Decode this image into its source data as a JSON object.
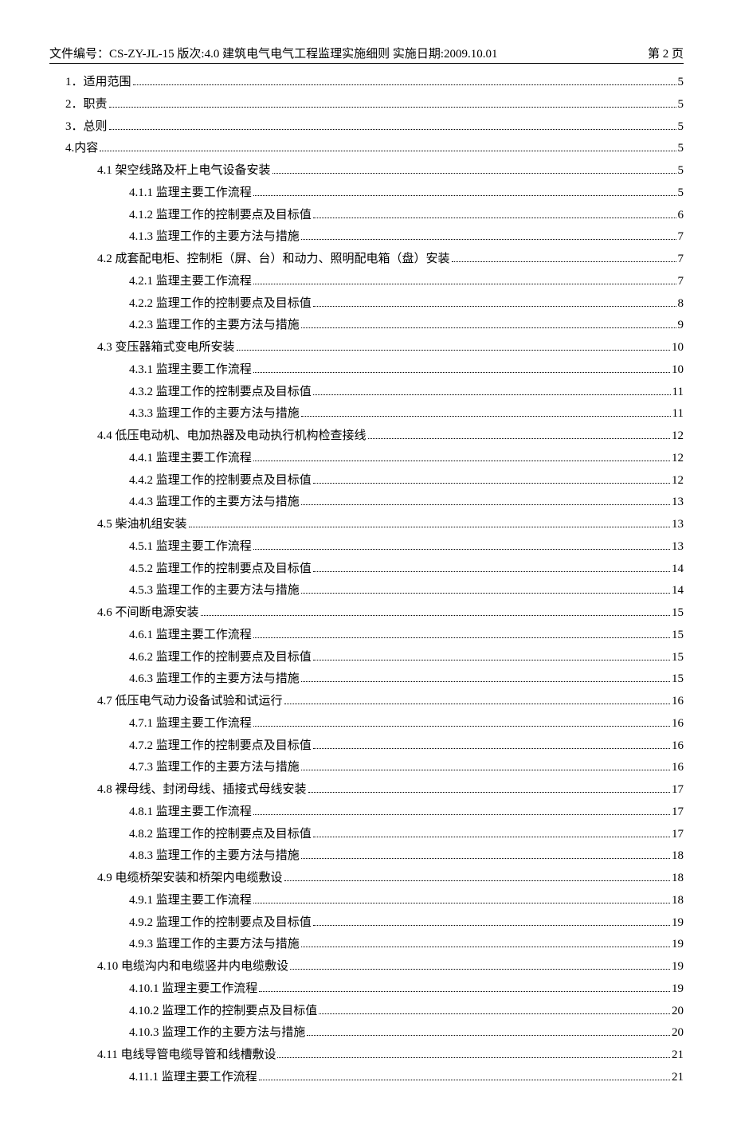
{
  "header": {
    "left": "文件编号：CS-ZY-JL-15 版次:4.0  建筑电气电气工程监理实施细则  实施日期:2009.10.01",
    "right": "第 2 页"
  },
  "toc": [
    {
      "indent": 0,
      "label": "1．适用范围",
      "page": "5"
    },
    {
      "indent": 0,
      "label": "2．职责",
      "page": "5"
    },
    {
      "indent": 0,
      "label": "3．总则",
      "page": "5"
    },
    {
      "indent": 0,
      "label": "4.内容",
      "page": "5"
    },
    {
      "indent": 1,
      "label": "4.1 架空线路及杆上电气设备安装",
      "page": "5"
    },
    {
      "indent": 2,
      "label": "4.1.1 监理主要工作流程",
      "page": "5"
    },
    {
      "indent": 2,
      "label": "4.1.2 监理工作的控制要点及目标值",
      "page": "6"
    },
    {
      "indent": 2,
      "label": "4.1.3 监理工作的主要方法与措施",
      "page": "7"
    },
    {
      "indent": 1,
      "label": "4.2 成套配电柜、控制柜（屏、台）和动力、照明配电箱（盘）安装",
      "page": "7"
    },
    {
      "indent": 2,
      "label": "4.2.1  监理主要工作流程",
      "page": "7"
    },
    {
      "indent": 2,
      "label": "4.2.2 监理工作的控制要点及目标值",
      "page": "8"
    },
    {
      "indent": 2,
      "label": "4.2.3  监理工作的主要方法与措施",
      "page": "9"
    },
    {
      "indent": 1,
      "label": "4.3 变压器箱式变电所安装",
      "page": "10"
    },
    {
      "indent": 2,
      "label": "4.3.1 监理主要工作流程",
      "page": "10"
    },
    {
      "indent": 2,
      "label": "4.3.2 监理工作的控制要点及目标值",
      "page": "11"
    },
    {
      "indent": 2,
      "label": "4.3.3  监理工作的主要方法与措施",
      "page": "11"
    },
    {
      "indent": 1,
      "label": "4.4 低压电动机、电加热器及电动执行机构检查接线",
      "page": "12"
    },
    {
      "indent": 2,
      "label": "4.4.1 监理主要工作流程",
      "page": "12"
    },
    {
      "indent": 2,
      "label": "4.4.2 监理工作的控制要点及目标值",
      "page": "12"
    },
    {
      "indent": 2,
      "label": "4.4.3 监理工作的主要方法与措施",
      "page": "13"
    },
    {
      "indent": 1,
      "label": "4.5 柴油机组安装",
      "page": "13"
    },
    {
      "indent": 2,
      "label": "4.5.1 监理主要工作流程",
      "page": "13"
    },
    {
      "indent": 2,
      "label": "4.5.2 监理工作的控制要点及目标值",
      "page": "14"
    },
    {
      "indent": 2,
      "label": "4.5.3  监理工作的主要方法与措施",
      "page": "14"
    },
    {
      "indent": 1,
      "label": "4.6 不间断电源安装",
      "page": "15"
    },
    {
      "indent": 2,
      "label": "4.6.1 监理主要工作流程",
      "page": "15"
    },
    {
      "indent": 2,
      "label": "4.6.2 监理工作的控制要点及目标值",
      "page": "15"
    },
    {
      "indent": 2,
      "label": "4.6.3 监理工作的主要方法与措施",
      "page": "15"
    },
    {
      "indent": 1,
      "label": "4.7 低压电气动力设备试验和试运行",
      "page": "16"
    },
    {
      "indent": 2,
      "label": "4.7.1 监理主要工作流程",
      "page": "16"
    },
    {
      "indent": 2,
      "label": "4.7.2 监理工作的控制要点及目标值",
      "page": "16"
    },
    {
      "indent": 2,
      "label": "4.7.3  监理工作的主要方法与措施",
      "page": "16"
    },
    {
      "indent": 1,
      "label": "4.8 裸母线、封闭母线、插接式母线安装",
      "page": "17"
    },
    {
      "indent": 2,
      "label": "4.8.1 监理主要工作流程",
      "page": "17"
    },
    {
      "indent": 2,
      "label": "4.8.2 监理工作的控制要点及目标值",
      "page": "17"
    },
    {
      "indent": 2,
      "label": "4.8.3  监理工作的主要方法与措施",
      "page": "18"
    },
    {
      "indent": 1,
      "label": "4.9 电缆桥架安装和桥架内电缆敷设",
      "page": "18"
    },
    {
      "indent": 2,
      "label": "4.9.1 监理主要工作流程",
      "page": "18"
    },
    {
      "indent": 2,
      "label": "4.9.2 监理工作的控制要点及目标值",
      "page": "19"
    },
    {
      "indent": 2,
      "label": "4.9.3  监理工作的主要方法与措施",
      "page": "19"
    },
    {
      "indent": 1,
      "label": "4.10 电缆沟内和电缆竖井内电缆敷设",
      "page": "19"
    },
    {
      "indent": 2,
      "label": "4.10.1 监理主要工作流程",
      "page": "19"
    },
    {
      "indent": 2,
      "label": "4.10.2 监理工作的控制要点及目标值",
      "page": "20"
    },
    {
      "indent": 2,
      "label": "4.10.3  监理工作的主要方法与措施",
      "page": "20"
    },
    {
      "indent": 1,
      "label": "4.11 电线导管电缆导管和线槽敷设",
      "page": "21"
    },
    {
      "indent": 2,
      "label": "4.11.1 监理主要工作流程",
      "page": "21"
    }
  ]
}
